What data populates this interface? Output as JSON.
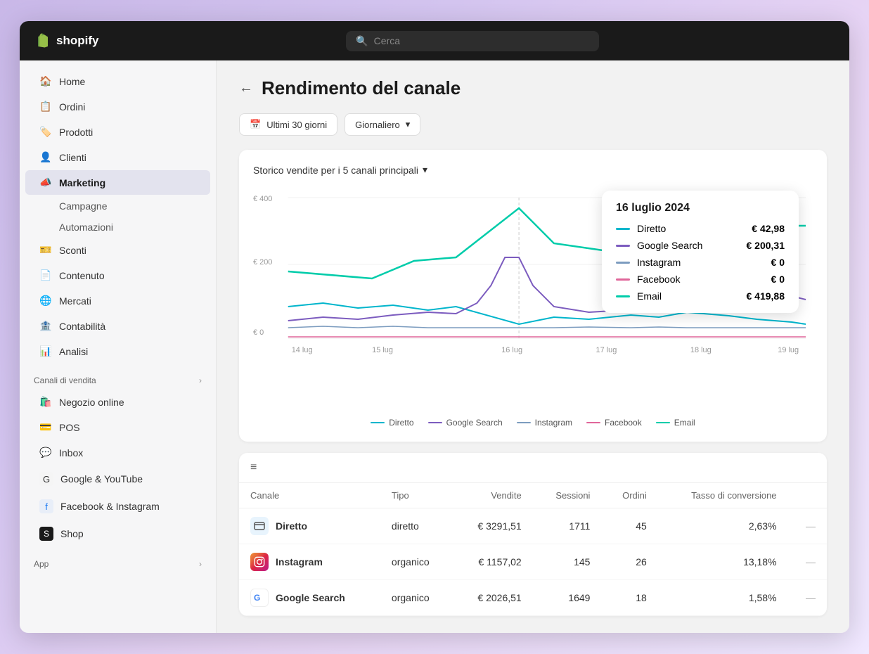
{
  "app": {
    "name": "shopify",
    "logo_text": "shopify"
  },
  "topbar": {
    "search_placeholder": "Cerca"
  },
  "sidebar": {
    "nav_items": [
      {
        "id": "home",
        "label": "Home",
        "icon": "home"
      },
      {
        "id": "ordini",
        "label": "Ordini",
        "icon": "orders"
      },
      {
        "id": "prodotti",
        "label": "Prodotti",
        "icon": "tag"
      },
      {
        "id": "clienti",
        "label": "Clienti",
        "icon": "person"
      },
      {
        "id": "marketing",
        "label": "Marketing",
        "icon": "megaphone",
        "active": true
      },
      {
        "id": "campagne",
        "label": "Campagne",
        "sub": true
      },
      {
        "id": "automazioni",
        "label": "Automazioni",
        "sub": true
      },
      {
        "id": "sconti",
        "label": "Sconti",
        "icon": "discount"
      },
      {
        "id": "contenuto",
        "label": "Contenuto",
        "icon": "content"
      },
      {
        "id": "mercati",
        "label": "Mercati",
        "icon": "globe"
      },
      {
        "id": "contabilita",
        "label": "Contabilità",
        "icon": "accounting"
      },
      {
        "id": "analisi",
        "label": "Analisi",
        "icon": "chart"
      }
    ],
    "canali_section": "Canali di vendita",
    "canali_items": [
      {
        "id": "negozio",
        "label": "Negozio online",
        "icon": "store"
      },
      {
        "id": "pos",
        "label": "POS",
        "icon": "pos"
      },
      {
        "id": "inbox",
        "label": "Inbox",
        "icon": "inbox"
      },
      {
        "id": "google",
        "label": "Google & YouTube",
        "icon": "google"
      },
      {
        "id": "facebook",
        "label": "Facebook & Instagram",
        "icon": "facebook"
      },
      {
        "id": "shop",
        "label": "Shop",
        "icon": "shop"
      }
    ],
    "app_section": "App"
  },
  "page": {
    "title": "Rendimento del canale",
    "back_label": "←"
  },
  "filters": {
    "date_label": "Ultimi 30 giorni",
    "period_label": "Giornaliero"
  },
  "chart": {
    "title": "Storico vendite per i 5 canali principali",
    "y_labels": [
      "€ 400",
      "€ 200",
      "€ 0"
    ],
    "x_labels": [
      "14 lug",
      "15 lug",
      "16 lug",
      "17 lug",
      "18 lug",
      "19 lug"
    ],
    "legend": [
      {
        "label": "Diretto",
        "color": "#00b5cc"
      },
      {
        "label": "Google Search",
        "color": "#7c5cbf"
      },
      {
        "label": "Instagram",
        "color": "#7c9cbf"
      },
      {
        "label": "Facebook",
        "color": "#e0669a"
      },
      {
        "label": "Email",
        "color": "#00ccaa"
      }
    ]
  },
  "tooltip": {
    "date": "16 luglio 2024",
    "rows": [
      {
        "label": "Diretto",
        "value": "€ 42,98",
        "color": "#00b5cc"
      },
      {
        "label": "Google Search",
        "value": "€ 200,31",
        "color": "#7c5cbf"
      },
      {
        "label": "Instagram",
        "value": "€ 0",
        "color": "#7c9cbf"
      },
      {
        "label": "Facebook",
        "value": "€ 0",
        "color": "#e0669a"
      },
      {
        "label": "Email",
        "value": "€ 419,88",
        "color": "#00ccaa"
      }
    ]
  },
  "table": {
    "columns": [
      "Canale",
      "Tipo",
      "Vendite",
      "Sessioni",
      "Ordini",
      "Tasso di conversione"
    ],
    "rows": [
      {
        "channel": "Diretto",
        "icon": "🏠",
        "icon_class": "icon-diretto",
        "tipo": "diretto",
        "vendite": "€ 3291,51",
        "sessioni": "1711",
        "ordini": "45",
        "tasso": "2,63%",
        "dash": "—"
      },
      {
        "channel": "Instagram",
        "icon": "📷",
        "icon_class": "icon-instagram",
        "tipo": "organico",
        "vendite": "€ 1157,02",
        "sessioni": "145",
        "ordini": "26",
        "tasso": "13,18%",
        "dash": "—"
      },
      {
        "channel": "Google Search",
        "icon": "🔍",
        "icon_class": "icon-google",
        "tipo": "organico",
        "vendite": "€ 2026,51",
        "sessioni": "1649",
        "ordini": "18",
        "tasso": "1,58%",
        "dash": "—"
      }
    ]
  }
}
